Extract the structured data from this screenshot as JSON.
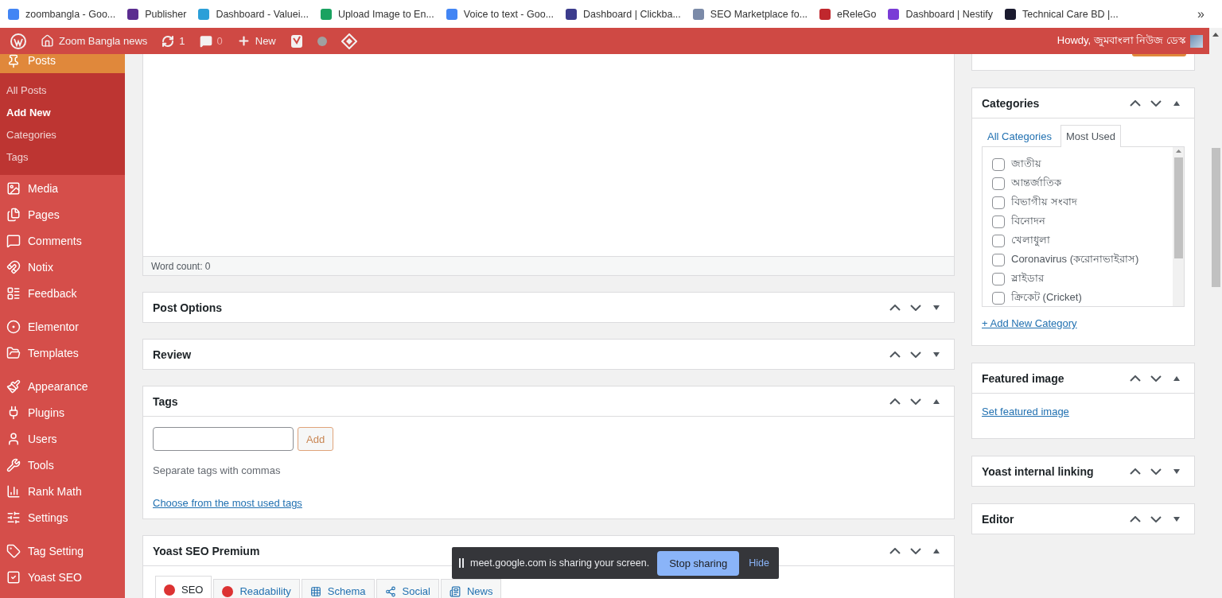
{
  "bookmarks": [
    {
      "label": "zoombangla - Goo...",
      "color": "#4285f4"
    },
    {
      "label": "Publisher",
      "color": "#5b2d90"
    },
    {
      "label": "Dashboard - Valuei...",
      "color": "#2b9fd8"
    },
    {
      "label": "Upload Image to En...",
      "color": "#1aa260"
    },
    {
      "label": "Voice to text - Goo...",
      "color": "#4285f4"
    },
    {
      "label": "Dashboard | Clickba...",
      "color": "#3c3c8c"
    },
    {
      "label": "SEO Marketplace fo...",
      "color": "#7b8aa8"
    },
    {
      "label": "eReleGo",
      "color": "#c0272d"
    },
    {
      "label": "Dashboard | Nestify",
      "color": "#7a3cd6"
    },
    {
      "label": "Technical Care BD |...",
      "color": "#1a1a2e"
    }
  ],
  "bookmarks_more": "»",
  "admin_bar": {
    "site_name": "Zoom Bangla news",
    "updates": "1",
    "comments": "0",
    "new_label": "New",
    "howdy": "Howdy, জুমবাংলা নিউজ ডেস্ক"
  },
  "sidebar": {
    "groups": [
      {
        "items": [
          {
            "label": "Posts",
            "selected": true,
            "children": [
              {
                "label": "All Posts",
                "selected": false
              },
              {
                "label": "Add New",
                "selected": true
              },
              {
                "label": "Categories",
                "selected": false
              },
              {
                "label": "Tags",
                "selected": false
              }
            ]
          },
          {
            "label": "Media",
            "selected": false
          },
          {
            "label": "Pages",
            "selected": false
          },
          {
            "label": "Comments",
            "selected": false
          },
          {
            "label": "Notix",
            "selected": false
          },
          {
            "label": "Feedback",
            "selected": false
          }
        ]
      },
      {
        "items": [
          {
            "label": "Elementor",
            "selected": false
          },
          {
            "label": "Templates",
            "selected": false
          }
        ]
      },
      {
        "items": [
          {
            "label": "Appearance",
            "selected": false
          },
          {
            "label": "Plugins",
            "selected": false
          },
          {
            "label": "Users",
            "selected": false
          },
          {
            "label": "Tools",
            "selected": false
          },
          {
            "label": "Rank Math",
            "selected": false
          },
          {
            "label": "Settings",
            "selected": false
          }
        ]
      },
      {
        "items": [
          {
            "label": "Tag Setting",
            "selected": false
          },
          {
            "label": "Yoast SEO",
            "selected": false
          }
        ]
      }
    ]
  },
  "editor": {
    "word_count": "Word count: 0"
  },
  "main_boxes": [
    {
      "kind": "plain",
      "title": "Post Options",
      "expanded": false
    },
    {
      "kind": "plain",
      "title": "Review",
      "expanded": false
    },
    {
      "kind": "tags",
      "title": "Tags",
      "expanded": true,
      "add_button": "Add",
      "hint": "Separate tags with commas",
      "link": "Choose from the most used tags"
    },
    {
      "kind": "yoast",
      "title": "Yoast SEO Premium",
      "expanded": true,
      "tabs": [
        {
          "label": "SEO",
          "kind": "score",
          "color": "#dc3232",
          "selected": true
        },
        {
          "label": "Readability",
          "kind": "score",
          "color": "#dc3232",
          "selected": false
        },
        {
          "label": "Schema",
          "kind": "grid",
          "selected": false
        },
        {
          "label": "Social",
          "kind": "share",
          "selected": false
        },
        {
          "label": "News",
          "kind": "news",
          "selected": false
        }
      ]
    }
  ],
  "side_boxes": [
    {
      "kind": "categories",
      "title": "Categories",
      "expanded": true,
      "tabs": [
        {
          "label": "All Categories",
          "selected": false
        },
        {
          "label": "Most Used",
          "selected": true
        }
      ],
      "items": [
        {
          "label": "জাতীয়",
          "checked": false
        },
        {
          "label": "আন্তর্জাতিক",
          "checked": false
        },
        {
          "label": "বিভাগীয় সংবাদ",
          "checked": false
        },
        {
          "label": "বিনোদন",
          "checked": false
        },
        {
          "label": "খেলাধুলা",
          "checked": false
        },
        {
          "label": "Coronavirus (করোনাভাইরাস)",
          "checked": false
        },
        {
          "label": "স্লাইডার",
          "checked": false
        },
        {
          "label": "ক্রিকেট (Cricket)",
          "checked": false
        }
      ],
      "add_link": "+ Add New Category"
    },
    {
      "kind": "featured",
      "title": "Featured image",
      "expanded": true,
      "link": "Set featured image"
    },
    {
      "kind": "plain",
      "title": "Yoast internal linking",
      "expanded": false
    },
    {
      "kind": "plain",
      "title": "Editor",
      "expanded": false
    }
  ],
  "share_bar": {
    "message": "meet.google.com is sharing your screen.",
    "stop_button": "Stop sharing",
    "hide_link": "Hide"
  }
}
